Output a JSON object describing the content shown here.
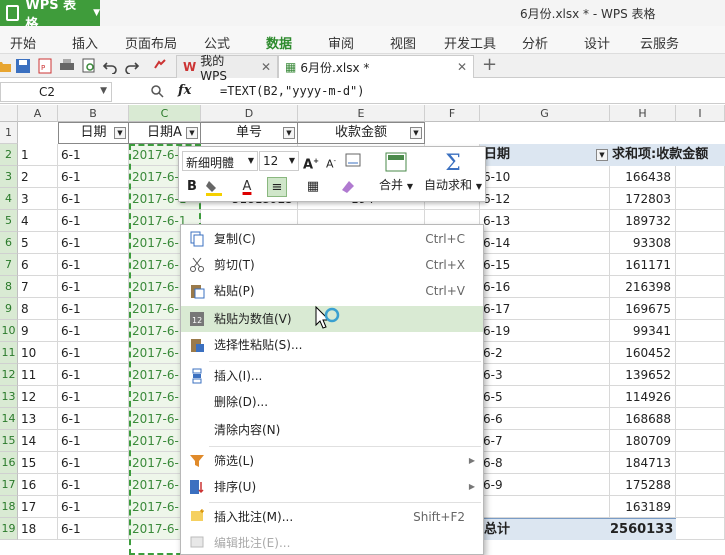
{
  "app": {
    "name": "WPS 表格",
    "window_title": "6月份.xlsx * - WPS 表格"
  },
  "ribbon_tabs": [
    "开始",
    "插入",
    "页面布局",
    "公式",
    "数据",
    "审阅",
    "视图",
    "开发工具",
    "分析",
    "设计",
    "云服务"
  ],
  "active_tab": "数据",
  "doc_tabs": [
    {
      "label": "我的WPS"
    },
    {
      "label": "6月份.xlsx *"
    }
  ],
  "formula_bar": {
    "cell_ref": "C2",
    "fx": "fx",
    "formula": "=TEXT(B2,\"yyyy-m-d\")"
  },
  "columns": [
    "A",
    "B",
    "C",
    "D",
    "E",
    "F",
    "G",
    "H",
    "I"
  ],
  "rows": [
    "1",
    "2",
    "3",
    "4",
    "5",
    "6",
    "7",
    "8",
    "9",
    "10",
    "11",
    "12",
    "13",
    "14",
    "15",
    "16",
    "17",
    "18",
    "19"
  ],
  "headers": {
    "b": "日期",
    "c": "日期A",
    "d": "单号",
    "e": "收款金额"
  },
  "col_a": [
    "1",
    "2",
    "3",
    "4",
    "5",
    "6",
    "7",
    "8",
    "9",
    "10",
    "11",
    "12",
    "13",
    "14",
    "15",
    "16",
    "17",
    "18",
    "19"
  ],
  "col_b": "6-1",
  "col_c": "2017-6-1",
  "col_d_visible": [
    {
      "row": 3,
      "value": "51814725"
    },
    {
      "row": 4,
      "value": "51813925"
    }
  ],
  "col_e_visible": [
    {
      "row": 3,
      "value": "197"
    },
    {
      "row": 4,
      "value": "194"
    }
  ],
  "pivot": {
    "header_label": "日期",
    "header_value": "求和项:收款金额",
    "labels": [
      "6-10",
      "6-12",
      "6-13",
      "6-14",
      "6-15",
      "6-16",
      "6-17",
      "6-19",
      "6-2",
      "6-3",
      "6-5",
      "6-6",
      "6-7",
      "6-8",
      "6-9"
    ],
    "values": [
      "166438",
      "172803",
      "189732",
      "93308",
      "161171",
      "216398",
      "169675",
      "99341",
      "160452",
      "139652",
      "114926",
      "168688",
      "180709",
      "184713",
      "175288",
      "163189"
    ],
    "total_label": "总计",
    "total_value": "2560133"
  },
  "mini_toolbar": {
    "font": "新细明體",
    "size": "12",
    "merge": "合并",
    "autosum": "自动求和"
  },
  "menu": {
    "items": [
      {
        "label": "复制(C)",
        "shortcut": "Ctrl+C"
      },
      {
        "label": "剪切(T)",
        "shortcut": "Ctrl+X"
      },
      {
        "label": "粘贴(P)",
        "shortcut": "Ctrl+V"
      },
      {
        "label": "粘贴为数值(V)",
        "shortcut": ""
      },
      {
        "label": "选择性粘贴(S)...",
        "shortcut": ""
      },
      {
        "label": "插入(I)...",
        "shortcut": ""
      },
      {
        "label": "删除(D)...",
        "shortcut": ""
      },
      {
        "label": "清除内容(N)",
        "shortcut": ""
      },
      {
        "label": "筛选(L)",
        "shortcut": ""
      },
      {
        "label": "排序(U)",
        "shortcut": ""
      },
      {
        "label": "插入批注(M)...",
        "shortcut": "Shift+F2"
      },
      {
        "label": "编辑批注(E)...",
        "shortcut": ""
      }
    ]
  },
  "colors": {
    "accent_green": "#3f9c3b",
    "pivot_blue": "#dce6f1",
    "selection": "#d9ead3"
  }
}
